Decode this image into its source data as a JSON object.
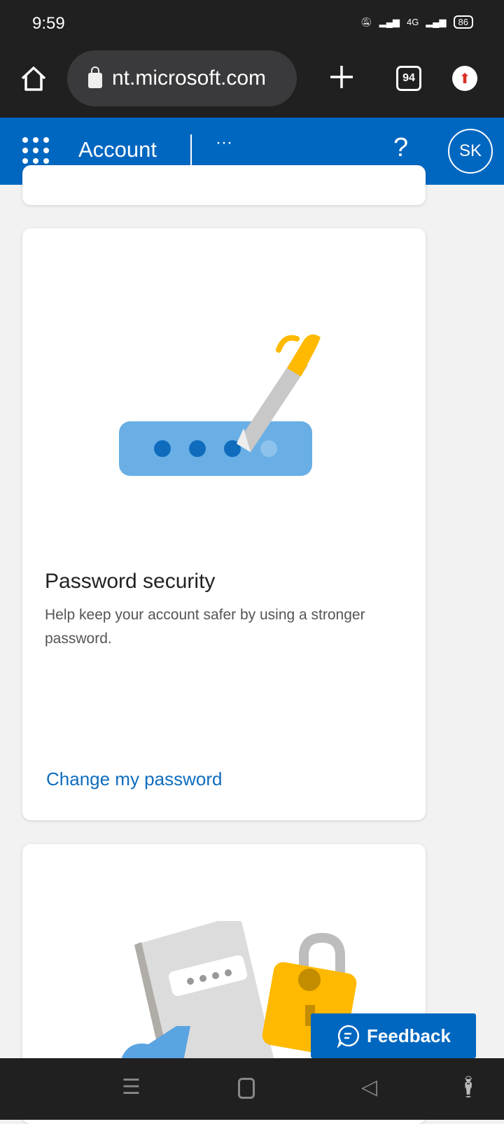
{
  "status_bar": {
    "time": "9:59",
    "network": "4G",
    "battery": "86"
  },
  "browser": {
    "url": "nt.microsoft.com",
    "tab_count": "94"
  },
  "header": {
    "title": "Account",
    "more": "···",
    "help": "?",
    "avatar_initials": "SK"
  },
  "password_card": {
    "title": "Password security",
    "description": "Help keep your account safer by using a stronger password.",
    "link": "Change my password"
  },
  "feedback": {
    "label": "Feedback"
  },
  "colors": {
    "brand": "#0067c0",
    "link": "#0f6cbd",
    "accent_yellow": "#ffb900"
  }
}
